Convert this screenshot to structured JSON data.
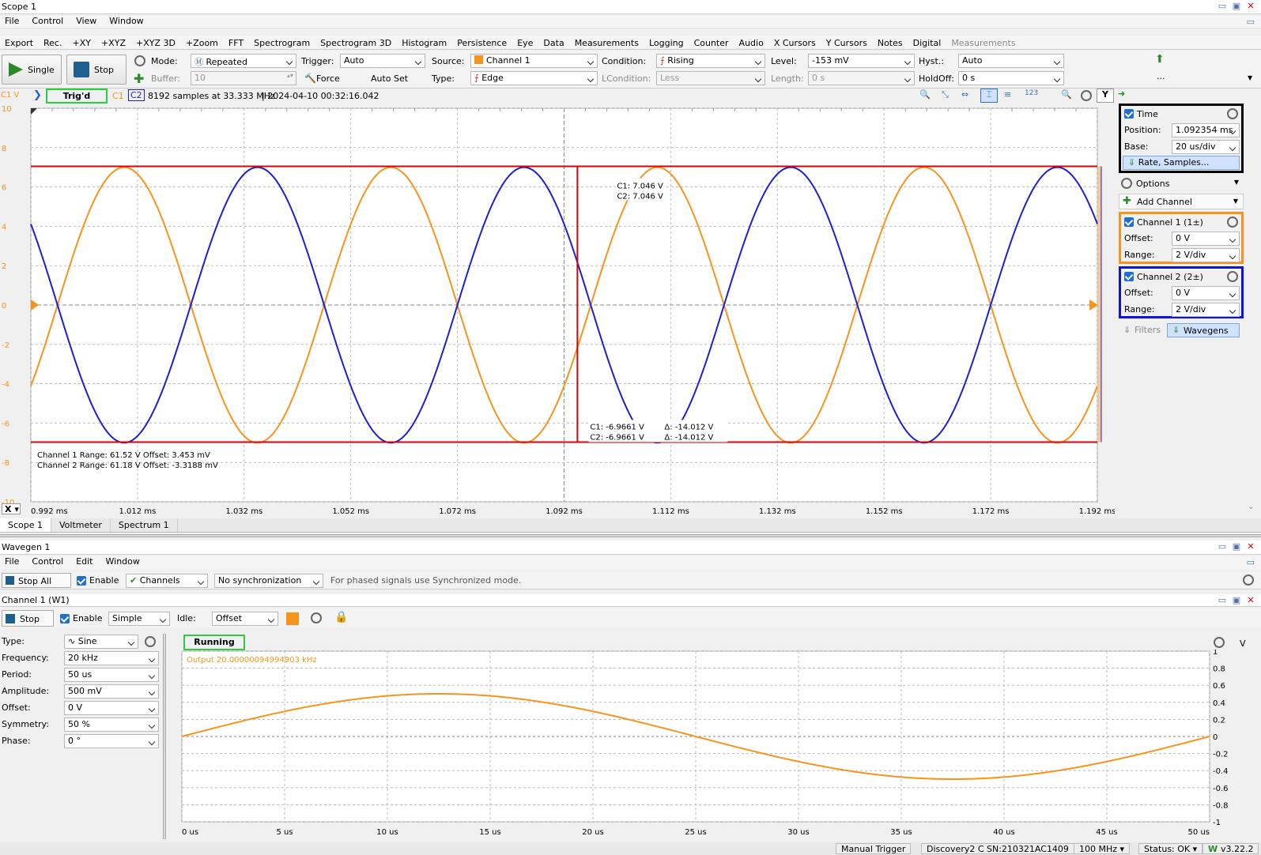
{
  "scope": {
    "title": "Scope 1",
    "menu": [
      "File",
      "Control",
      "View",
      "Window"
    ],
    "toolmenu": [
      "Export",
      "Rec.",
      "+XY",
      "+XYZ",
      "+XYZ 3D",
      "+Zoom",
      "FFT",
      "Spectrogram",
      "Spectrogram 3D",
      "Histogram",
      "Persistence",
      "Eye",
      "Data",
      "Measurements",
      "Logging",
      "Counter",
      "Audio",
      "X Cursors",
      "Y Cursors",
      "Notes",
      "Digital"
    ],
    "toolmenu_disabled": "Measurements",
    "single_label": "Single",
    "stop_label": "Stop",
    "mode_label": "Mode:",
    "mode_value": "Repeated",
    "buffer_label": "Buffer:",
    "buffer_value": "10",
    "trigger_label": "Trigger:",
    "trigger_value": "Auto",
    "force_label": "Force",
    "autoset_label": "Auto Set",
    "source_label": "Source:",
    "source_value": "Channel 1",
    "type_label": "Type:",
    "type_value": "Edge",
    "condition_label": "Condition:",
    "condition_value": "Rising",
    "lcondition_label": "LCondition:",
    "lcondition_value": "Less",
    "level_label": "Level:",
    "level_value": "-153 mV",
    "length_label": "Length:",
    "length_value": "0 s",
    "hyst_label": "Hyst.:",
    "hyst_value": "Auto",
    "holdoff_label": "HoldOff:",
    "holdoff_value": "0 s",
    "more_label": "...",
    "c1v_label": "C1 V",
    "trig_status": "Trig'd",
    "c1_tag": "C1",
    "c2_tag": "C2",
    "samples_info": "8192 samples at 33.333 MHz",
    "timestamp": "| 2024-04-10 00:32:16.042",
    "y_label": "Y",
    "x_label": "X",
    "cursor_top": [
      "C1: 7.046 V",
      "C2: 7.046 V"
    ],
    "cursor_bottom": [
      "C1: -6.9661 V",
      "C2: -6.9661 V"
    ],
    "cursor_delta": [
      "Δ: -14.012 V",
      "Δ: -14.012 V"
    ],
    "ch_info": [
      "Channel 1  Range: 61.52 V  Offset: 3.453 mV",
      "Channel 2  Range: 61.18 V  Offset: -3.3188 mV"
    ],
    "tabs": [
      "Scope 1",
      "Voltmeter",
      "Spectrum 1"
    ],
    "right_panel": {
      "time_title": "Time",
      "position_label": "Position:",
      "position_value": "1.092354 ms",
      "base_label": "Base:",
      "base_value": "20 us/div",
      "rate_label": "Rate, Samples...",
      "options_label": "Options",
      "add_channel_label": "Add Channel",
      "ch1_title": "Channel 1 (1±)",
      "ch1_offset_label": "Offset:",
      "ch1_offset_value": "0 V",
      "ch1_range_label": "Range:",
      "ch1_range_value": "2 V/div",
      "ch2_title": "Channel 2 (2±)",
      "ch2_offset_label": "Offset:",
      "ch2_offset_value": "0 V",
      "ch2_range_label": "Range:",
      "ch2_range_value": "2 V/div",
      "filters_label": "Filters",
      "wavegens_label": "Wavegens"
    }
  },
  "wavegen": {
    "title": "Wavegen 1",
    "menu": [
      "File",
      "Control",
      "Edit",
      "Window"
    ],
    "stop_all_label": "Stop All",
    "enable_label": "Enable",
    "channels_label": "Channels",
    "sync_value": "No synchronization",
    "sync_hint": "For phased signals use Synchronized mode.",
    "channel_title": "Channel 1 (W1)",
    "stop_label": "Stop",
    "enable2_label": "Enable",
    "mode_value": "Simple",
    "idle_label": "Idle:",
    "idle_value": "Offset",
    "params": [
      {
        "k": "Type:",
        "v": "Sine"
      },
      {
        "k": "Frequency:",
        "v": "20 kHz"
      },
      {
        "k": "Period:",
        "v": "50 us"
      },
      {
        "k": "Amplitude:",
        "v": "500 mV"
      },
      {
        "k": "Offset:",
        "v": "0 V"
      },
      {
        "k": "Symmetry:",
        "v": "50 %"
      },
      {
        "k": "Phase:",
        "v": "0 °"
      }
    ],
    "running_label": "Running",
    "output_label": "Output 20.00000094994903 kHz",
    "v_label": "V"
  },
  "status": {
    "manual_trigger": "Manual Trigger",
    "device": "Discovery2 C SN:210321AC1409",
    "clock": "100 MHz",
    "status": "Status: OK",
    "version": "v3.22.2"
  },
  "colors": {
    "ch1": "#f7941d",
    "ch2": "#1f1fd0",
    "cursor": "#e00000",
    "trig": "#2ecc40",
    "ch1_box": "#f7941d",
    "ch2_box": "#1010e0"
  },
  "chart_data": [
    {
      "type": "line",
      "x_ticks": [
        "0.992 ms",
        "1.012 ms",
        "1.032 ms",
        "1.052 ms",
        "1.072 ms",
        "1.092 ms",
        "1.112 ms",
        "1.132 ms",
        "1.152 ms",
        "1.172 ms",
        "1.192 ms"
      ],
      "y_ticks": [
        "10",
        "8",
        "6",
        "4",
        "2",
        "0",
        "-2",
        "-4",
        "-6",
        "-8",
        "-10"
      ],
      "xlim": [
        0.992,
        1.192
      ],
      "ylim": [
        -10,
        10
      ],
      "series": [
        {
          "name": "C1",
          "amplitude": 7.0,
          "period_ms": 0.05,
          "peak_at_ms": 1.0095
        },
        {
          "name": "C2",
          "amplitude": 7.0,
          "period_ms": 0.05,
          "peak_at_ms": 1.0345
        }
      ],
      "cursors": {
        "x_ms": 1.0945,
        "y_top": 7.046,
        "y_bottom": -6.9661
      }
    },
    {
      "type": "line",
      "x_ticks": [
        "0 us",
        "5 us",
        "10 us",
        "15 us",
        "20 us",
        "25 us",
        "30 us",
        "35 us",
        "40 us",
        "45 us",
        "50 us"
      ],
      "y_ticks": [
        "1",
        "0.8",
        "0.6",
        "0.4",
        "0.2",
        "0",
        "-0.2",
        "-0.4",
        "-0.6",
        "-0.8",
        "-1"
      ],
      "xlim": [
        0,
        50
      ],
      "ylim": [
        -1,
        1
      ],
      "series": [
        {
          "name": "W1",
          "amplitude": 0.5,
          "period_us": 50,
          "phase_deg": 0
        }
      ]
    }
  ]
}
